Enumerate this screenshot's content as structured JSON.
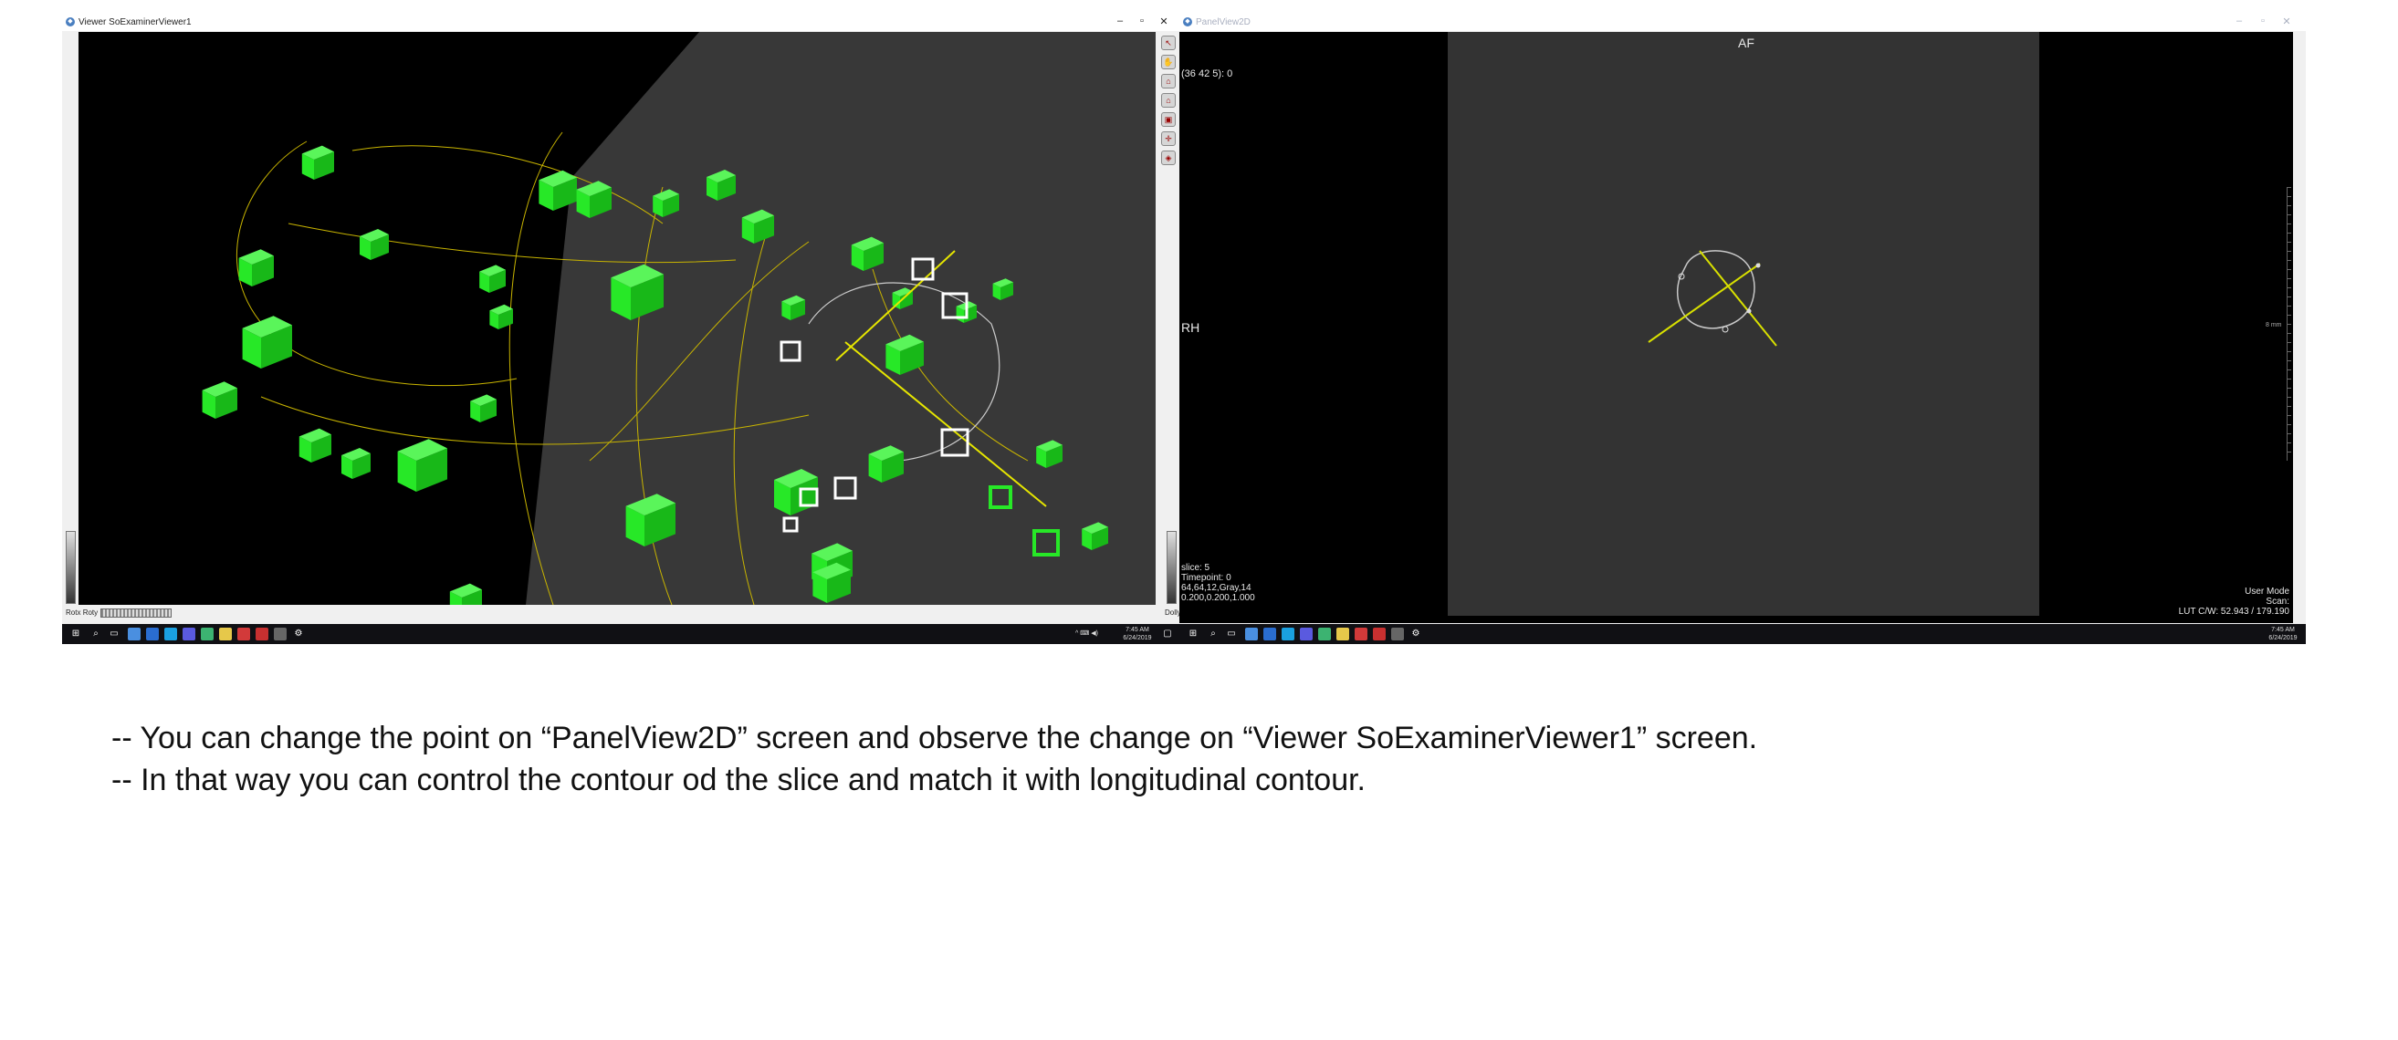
{
  "viewer_window": {
    "title": "Viewer SoExaminerViewer1",
    "bottom_left_labels": [
      "Rotx",
      "Roty"
    ],
    "bottom_right_label": "Dolly",
    "tool_icons": [
      "pick-arrow-icon",
      "view-hand-icon",
      "home-icon",
      "set-home-icon",
      "view-all-icon",
      "seek-icon",
      "projection-icon"
    ]
  },
  "panel_window": {
    "title": "PanelView2D",
    "orientation_top": "AF",
    "orientation_left": "RH",
    "coord_readout": "(36 42 5): 0",
    "slice_info": [
      "slice:  5",
      "Timepoint: 0",
      "64,64,12,Gray,14",
      "0.200,0.200,1.000"
    ],
    "user_mode": [
      "User Mode",
      "Scan:",
      "LUT C/W: 52.943 / 179.190"
    ],
    "ruler_label": "8 mm"
  },
  "taskbar": {
    "time": "7:45 AM",
    "date": "6/24/2019"
  },
  "caption": {
    "line1": "-- You can change the point on  “PanelView2D” screen and observe the change on “Viewer SoExaminerViewer1” screen.",
    "line2": "-- In that way you can control the contour od the slice and match it with longitudinal contour."
  },
  "colors": {
    "cube_green": "#27e827",
    "contour_yellow": "#c8b400",
    "panel_gray": "#333333",
    "marker_white": "#ffffff"
  }
}
